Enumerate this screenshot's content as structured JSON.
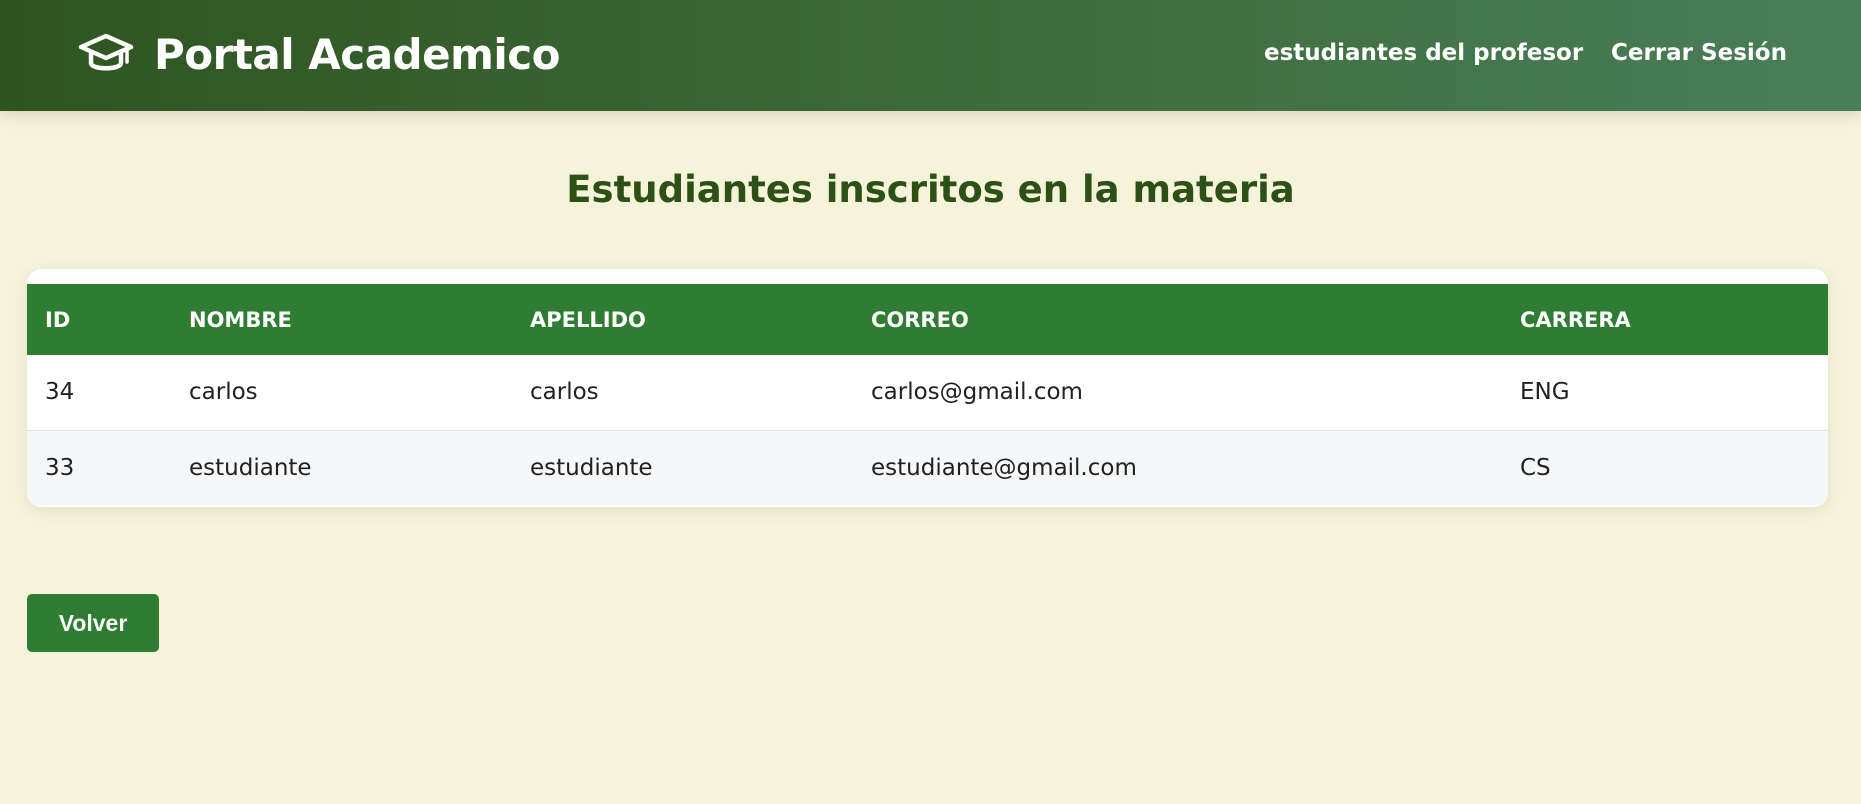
{
  "header": {
    "brand_icon": "graduation-cap-icon",
    "brand_title": "Portal Academico",
    "nav": {
      "students_label": "estudiantes del profesor",
      "logout_label": "Cerrar Sesión"
    }
  },
  "main": {
    "title": "Estudiantes inscritos en la materia",
    "table": {
      "columns": [
        "ID",
        "NOMBRE",
        "APELLIDO",
        "CORREO",
        "CARRERA"
      ],
      "rows": [
        [
          "34",
          "carlos",
          "carlos",
          "carlos@gmail.com",
          "ENG"
        ],
        [
          "33",
          "estudiante",
          "estudiante",
          "estudiante@gmail.com",
          "CS"
        ]
      ]
    },
    "back_button_label": "Volver"
  },
  "colors": {
    "header_gradient_start": "#2f5420",
    "header_gradient_end": "#4a7e5a",
    "accent_green": "#2e7d32",
    "title_green": "#2d5016",
    "page_background": "#f5f3d9"
  }
}
